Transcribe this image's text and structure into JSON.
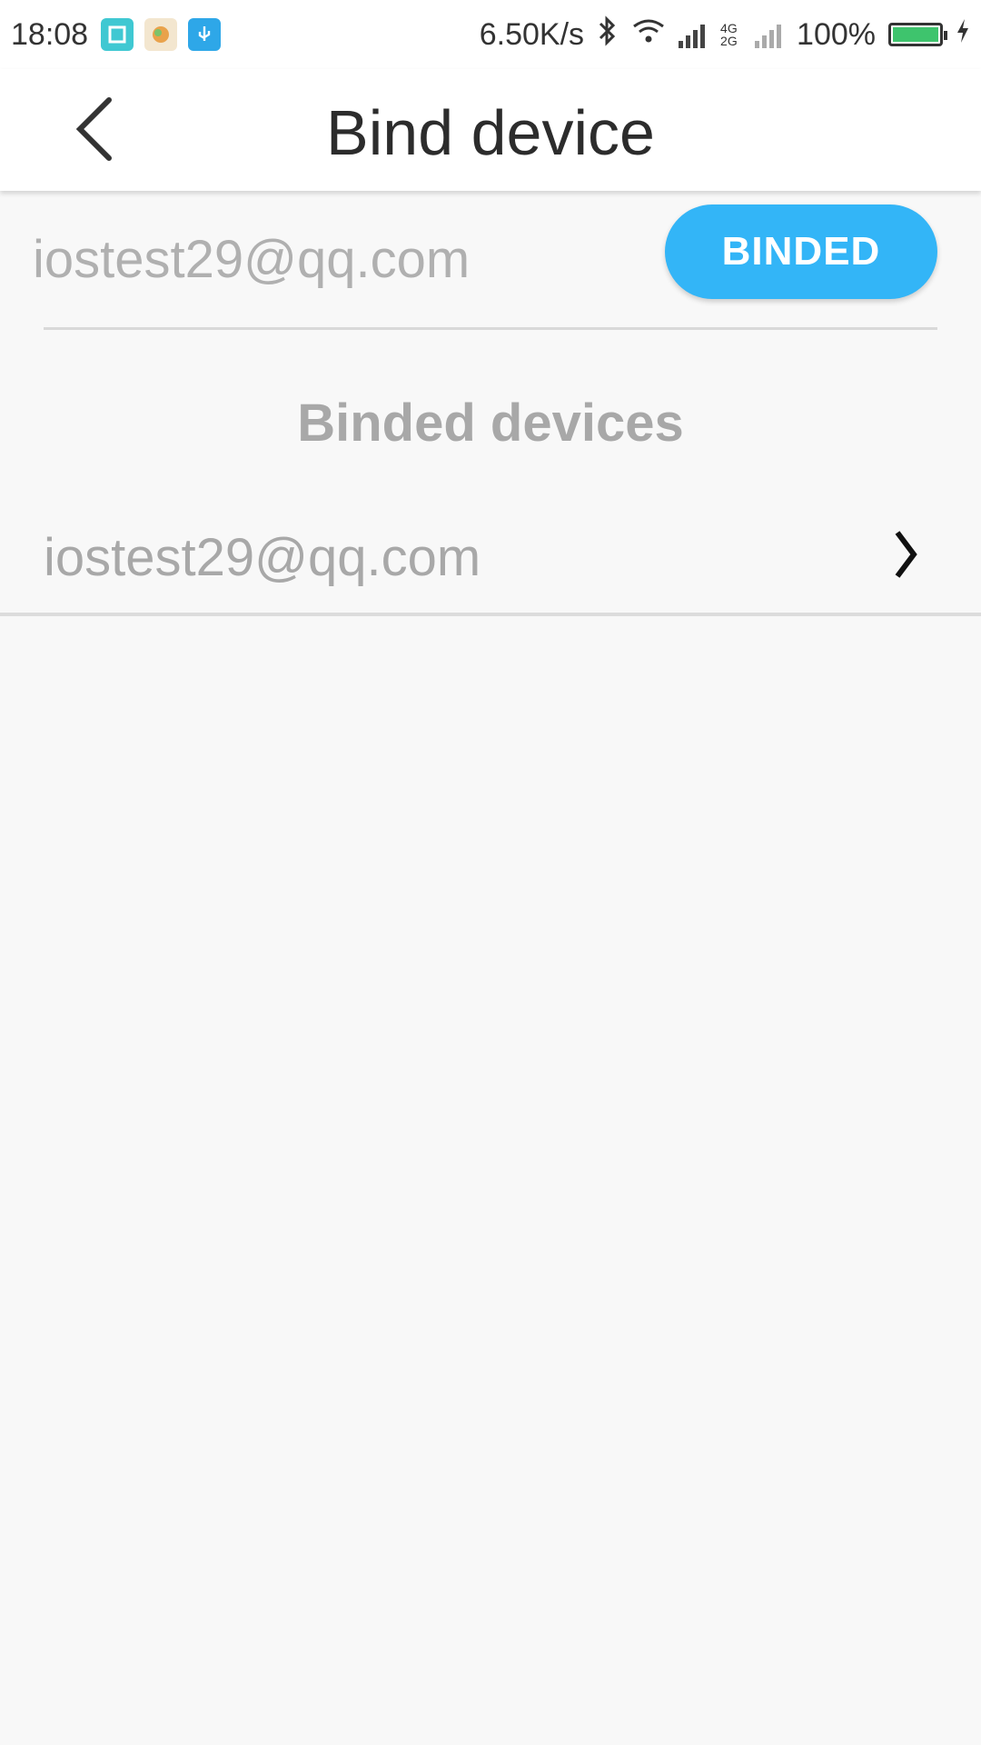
{
  "status_bar": {
    "time": "18:08",
    "network_speed": "6.50K/s",
    "battery": "100%",
    "network_type": "4G 2G",
    "icons": [
      "screenshot-icon",
      "app-icon",
      "usb-icon",
      "bluetooth-icon",
      "wifi-icon",
      "signal-icon",
      "battery-icon"
    ]
  },
  "header": {
    "title": "Bind device"
  },
  "binding": {
    "email": "iostest29@qq.com",
    "button_label": "BINDED",
    "button_color": "#33b5f7"
  },
  "binded_devices": {
    "title": "Binded devices",
    "items": [
      {
        "email": "iostest29@qq.com"
      }
    ]
  }
}
